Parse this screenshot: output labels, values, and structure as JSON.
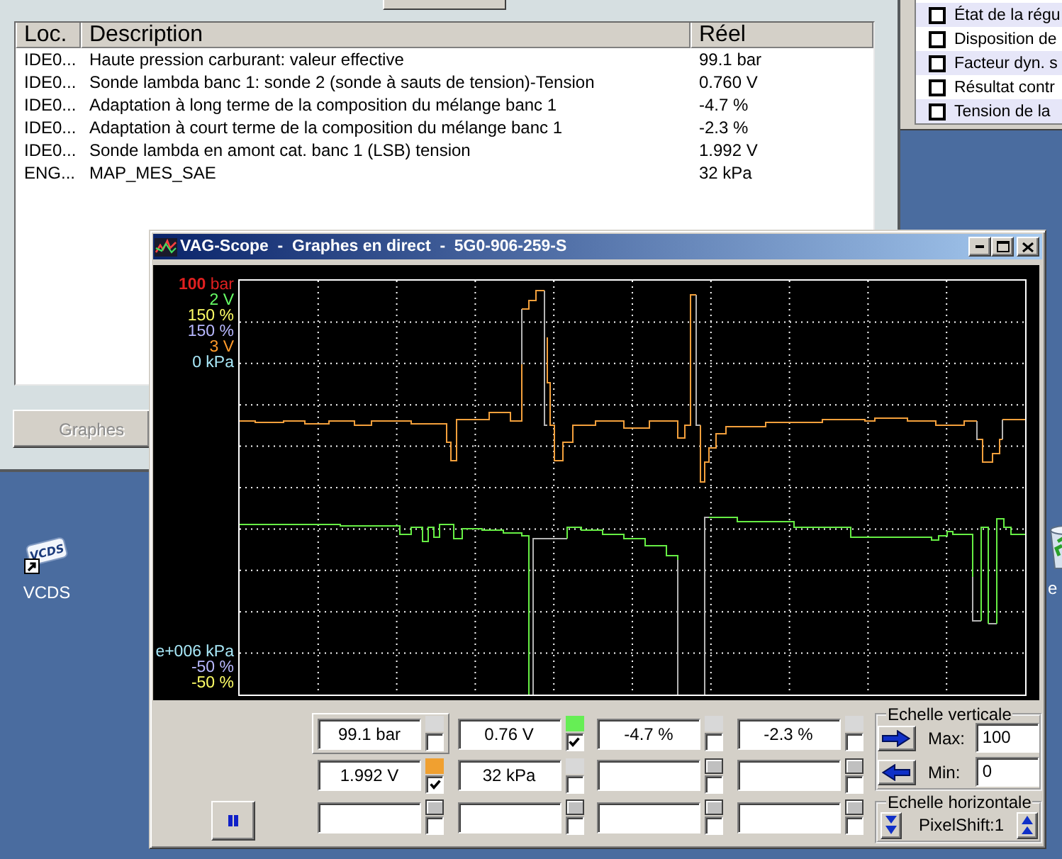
{
  "main_window": {
    "table": {
      "columns": [
        "Loc.",
        "Description",
        "Réel"
      ],
      "rows": [
        [
          "IDE0...",
          "Haute pression carburant: valeur effective",
          "99.1 bar"
        ],
        [
          "IDE0...",
          "Sonde lambda banc 1: sonde 2 (sonde à sauts de tension)-Tension",
          "0.760 V"
        ],
        [
          "IDE0...",
          "Adaptation à long terme de la composition du mélange banc 1",
          "-4.7 %"
        ],
        [
          "IDE0...",
          "Adaptation à court terme de la composition du mélange banc 1",
          "-2.3 %"
        ],
        [
          "IDE0...",
          "Sonde lambda en amont cat. banc 1 (LSB) tension",
          "1.992 V"
        ],
        [
          "ENG...",
          "MAP_MES_SAE",
          "32 kPa"
        ]
      ]
    },
    "graph_button": {
      "label": "Graphes",
      "disabled": true
    }
  },
  "list_window": {
    "items": [
      {
        "label": "État de la régu",
        "checked": false
      },
      {
        "label": "Disposition de",
        "checked": false
      },
      {
        "label": "Facteur dyn. s",
        "checked": false
      },
      {
        "label": "Résultat contr",
        "checked": false
      },
      {
        "label": "Tension de la",
        "checked": false
      }
    ]
  },
  "desktop_icons": [
    {
      "kind": "app",
      "logo": "VCDS",
      "label": "VCDS"
    },
    {
      "kind": "bin",
      "label": "e"
    }
  ],
  "scope_window": {
    "title": "VAG-Scope  -  Graphes en direct  -  5G0-906-259-S",
    "scale_top": [
      {
        "text": "**100** bar",
        "color": "#e02020"
      },
      {
        "text": "2 V",
        "color": "#66ff66"
      },
      {
        "text": "150 %",
        "color": "#ffff66"
      },
      {
        "text": "150 %",
        "color": "#b8b8ff"
      },
      {
        "text": "3 V",
        "color": "#ff9a2a"
      },
      {
        "text": "0 kPa",
        "color": "#a8e8f8"
      }
    ],
    "scale_bottom": [
      {
        "text": "e+006 kPa",
        "color": "#a8e8f8"
      },
      {
        "text": "-50 %",
        "color": "#b8b8ff"
      },
      {
        "text": "-50 %",
        "color": "#ffff66"
      }
    ],
    "channels": [
      {
        "kind": "signal",
        "value": "99.1 bar",
        "color": "#d8d8d8",
        "checked": false,
        "selected": true
      },
      {
        "kind": "signal",
        "value": "0.76 V",
        "color": "#66ee55",
        "checked": true,
        "selected": false
      },
      {
        "kind": "signal",
        "value": "-4.7 %",
        "color": "#d8d8d8",
        "checked": false,
        "selected": false
      },
      {
        "kind": "signal",
        "value": "-2.3 %",
        "color": "#d8d8d8",
        "checked": false,
        "selected": false
      },
      {
        "kind": "signal",
        "value": "1.992 V",
        "color": "#f0a030",
        "checked": true,
        "selected": false
      },
      {
        "kind": "signal",
        "value": "32 kPa",
        "color": "#d8d8d8",
        "checked": false,
        "selected": false
      },
      {
        "kind": "empty",
        "color": "#c0c0c0",
        "checked": false,
        "selected": false
      },
      {
        "kind": "empty",
        "color": "#c0c0c0",
        "checked": false,
        "selected": false
      },
      {
        "kind": "empty",
        "color": "#c0c0c0",
        "checked": false,
        "selected": false
      },
      {
        "kind": "empty",
        "color": "#c0c0c0",
        "checked": false,
        "selected": false
      },
      {
        "kind": "empty",
        "color": "#c0c0c0",
        "checked": false,
        "selected": false
      },
      {
        "kind": "empty",
        "color": "#c0c0c0",
        "checked": false,
        "selected": false
      }
    ],
    "vertical_scale": {
      "title": "Echelle verticale",
      "max_label": "Max:",
      "max_value": "100",
      "min_label": "Min:",
      "min_value": "0"
    },
    "horizontal_scale": {
      "title": "Echelle horizontale",
      "value": "PixelShift:1"
    }
  }
}
